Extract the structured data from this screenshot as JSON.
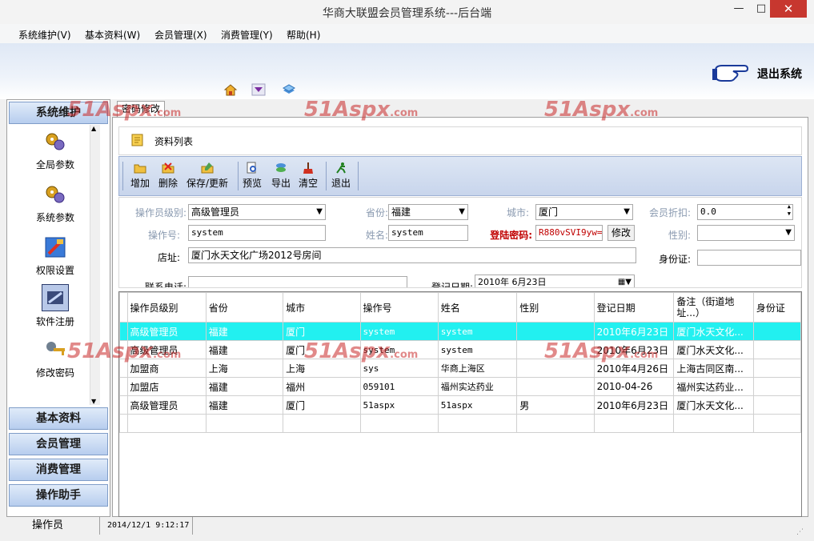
{
  "window": {
    "title": "华商大联盟会员管理系统---后台端",
    "min": "—",
    "max": "□",
    "close": "✕"
  },
  "menu": [
    "系统维护(V)",
    "基本资料(W)",
    "会员管理(X)",
    "消费管理(Y)",
    "帮助(H)"
  ],
  "banner": {
    "exit_label": "退出系统"
  },
  "nav": {
    "sections": [
      "系统维护",
      "基本资料",
      "会员管理",
      "消费管理",
      "操作助手"
    ],
    "items": [
      "全局参数",
      "系统参数",
      "权限设置",
      "软件注册",
      "修改密码"
    ]
  },
  "tab": {
    "label": "密码修改"
  },
  "list": {
    "title": "资料列表"
  },
  "toolbar": [
    "增加",
    "删除",
    "保存/更新",
    "预览",
    "导出",
    "清空",
    "退出"
  ],
  "form": {
    "level_label": "操作员级别:",
    "level_value": "高级管理员",
    "province_label": "省份:",
    "province_value": "福建",
    "city_label": "城市:",
    "city_value": "厦门",
    "discount_label": "会员折扣:",
    "discount_value": "0.0",
    "opno_label": "操作号:",
    "opno_value": "system",
    "name_label": "姓名:",
    "name_value": "system",
    "pwd_label": "登陆密码:",
    "pwd_value": "R880vSVI9yw=",
    "modify_label": "修改",
    "gender_label": "性别:",
    "gender_value": "",
    "address_label": "店址:",
    "address_value": "厦门水天文化广场2012号房间",
    "idcard_label": "身份证:",
    "idcard_value": "",
    "phone_label": "联系电话:",
    "phone_value": "",
    "regdate_label": "登记日期:",
    "regdate_value": "2010年 6月23日"
  },
  "grid": {
    "columns": [
      "操作员级别",
      "省份",
      "城市",
      "操作号",
      "姓名",
      "性别",
      "登记日期",
      "备注（街道地址...）",
      "身份证"
    ],
    "rows": [
      [
        "高级管理员",
        "福建",
        "厦门",
        "system",
        "system",
        "",
        "2010年6月23日",
        "厦门水天文化...",
        ""
      ],
      [
        "高级管理员",
        "福建",
        "厦门",
        "system",
        "system",
        "",
        "2010年6月23日",
        "厦门水天文化...",
        ""
      ],
      [
        "加盟商",
        "上海",
        "上海",
        "sys",
        "华商上海区",
        "",
        "2010年4月26日",
        "上海古同区南...",
        ""
      ],
      [
        "加盟店",
        "福建",
        "福州",
        "059101",
        "福州实达药业",
        "",
        "2010-04-26",
        "福州实达药业...",
        ""
      ],
      [
        "高级管理员",
        "福建",
        "厦门",
        "51aspx",
        "51aspx",
        "男",
        "2010年6月23日",
        "厦门水天文化...",
        ""
      ]
    ]
  },
  "status": {
    "user": "操作员",
    "datetime": "2014/12/1 9:12:17"
  },
  "colors": {
    "selected_row": "#22f0f0",
    "nav_header": "#b7cdee",
    "toolbar": "#c8d5ec",
    "password_label": "#c00000"
  }
}
